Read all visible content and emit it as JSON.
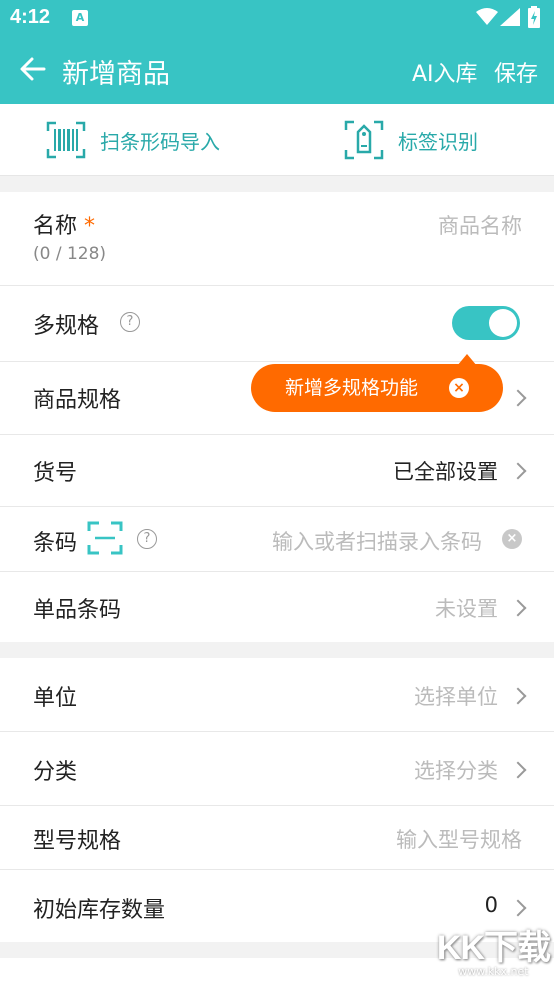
{
  "status": {
    "time": "4:12"
  },
  "appbar": {
    "title": "新增商品",
    "ai_label": "AI入库",
    "save_label": "保存"
  },
  "quick": {
    "scan_label": "扫条形码导入",
    "tag_label": "标签识别"
  },
  "form": {
    "name": {
      "label": "名称",
      "required": "*",
      "placeholder": "商品名称",
      "counter": "(0 / 128)"
    },
    "multi_spec": {
      "label": "多规格",
      "help": "?",
      "enabled": true
    },
    "spec": {
      "label": "商品规格"
    },
    "tooltip": {
      "text": "新增多规格功能",
      "close": "×"
    },
    "sku": {
      "label": "货号",
      "value": "已全部设置"
    },
    "barcode": {
      "label": "条码",
      "help": "?",
      "placeholder": "输入或者扫描录入条码",
      "clear": "×"
    },
    "single_barcode": {
      "label": "单品条码",
      "value": "未设置"
    },
    "unit": {
      "label": "单位",
      "value": "选择单位"
    },
    "category": {
      "label": "分类",
      "value": "选择分类"
    },
    "model": {
      "label": "型号规格",
      "placeholder": "输入型号规格"
    },
    "stock": {
      "label": "初始库存数量",
      "value": "0"
    }
  },
  "colors": {
    "primary": "#38c4c4",
    "accent": "#ff6a00",
    "tint": "#29a9a9"
  },
  "watermark": {
    "big": "KK下载",
    "small": "www.kkx.net"
  }
}
